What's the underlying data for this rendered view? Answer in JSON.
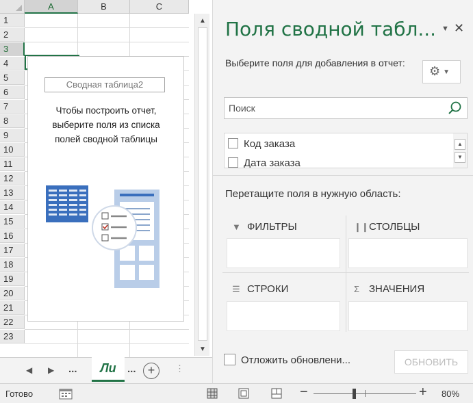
{
  "spreadsheet": {
    "columns": [
      "A",
      "B",
      "C"
    ],
    "rows": [
      "1",
      "2",
      "3",
      "4",
      "5",
      "6",
      "7",
      "8",
      "9",
      "10",
      "11",
      "12",
      "13",
      "14",
      "15",
      "16",
      "17",
      "18",
      "19",
      "20",
      "21",
      "22",
      "23"
    ],
    "selected_cell": "A3",
    "pivot_placeholder": {
      "name": "Сводная таблица2",
      "hint_lines": [
        "Чтобы построить отчет,",
        "выберите поля из списка",
        "полей сводной таблицы"
      ]
    }
  },
  "sheet_tabs": {
    "active_tab": "Ли",
    "ellipsis_left": "...",
    "ellipsis_right": "...",
    "add_symbol": "+"
  },
  "pivot_panel": {
    "title": "Поля сводной табл...",
    "choose_label": "Выберите поля для добавления в отчет:",
    "search": {
      "placeholder": "Поиск",
      "value": ""
    },
    "fields": [
      {
        "label": "Код заказа",
        "checked": false
      },
      {
        "label": "Дата заказа",
        "checked": false
      }
    ],
    "drag_label": "Перетащите поля в нужную область:",
    "areas": {
      "filters": "ФИЛЬТРЫ",
      "columns": "СТОЛБЦЫ",
      "rows": "СТРОКИ",
      "values": "ЗНАЧЕНИЯ"
    },
    "defer_label": "Отложить обновлени...",
    "update_button": "ОБНОВИТЬ"
  },
  "status_bar": {
    "status": "Готово",
    "zoom": "80%",
    "zoom_fraction": 0.4
  },
  "colors": {
    "accent": "#217346",
    "panel_bg": "#f3f3f3",
    "illustration_blue": "#3a6fbd",
    "illustration_light": "#b9cde8"
  }
}
